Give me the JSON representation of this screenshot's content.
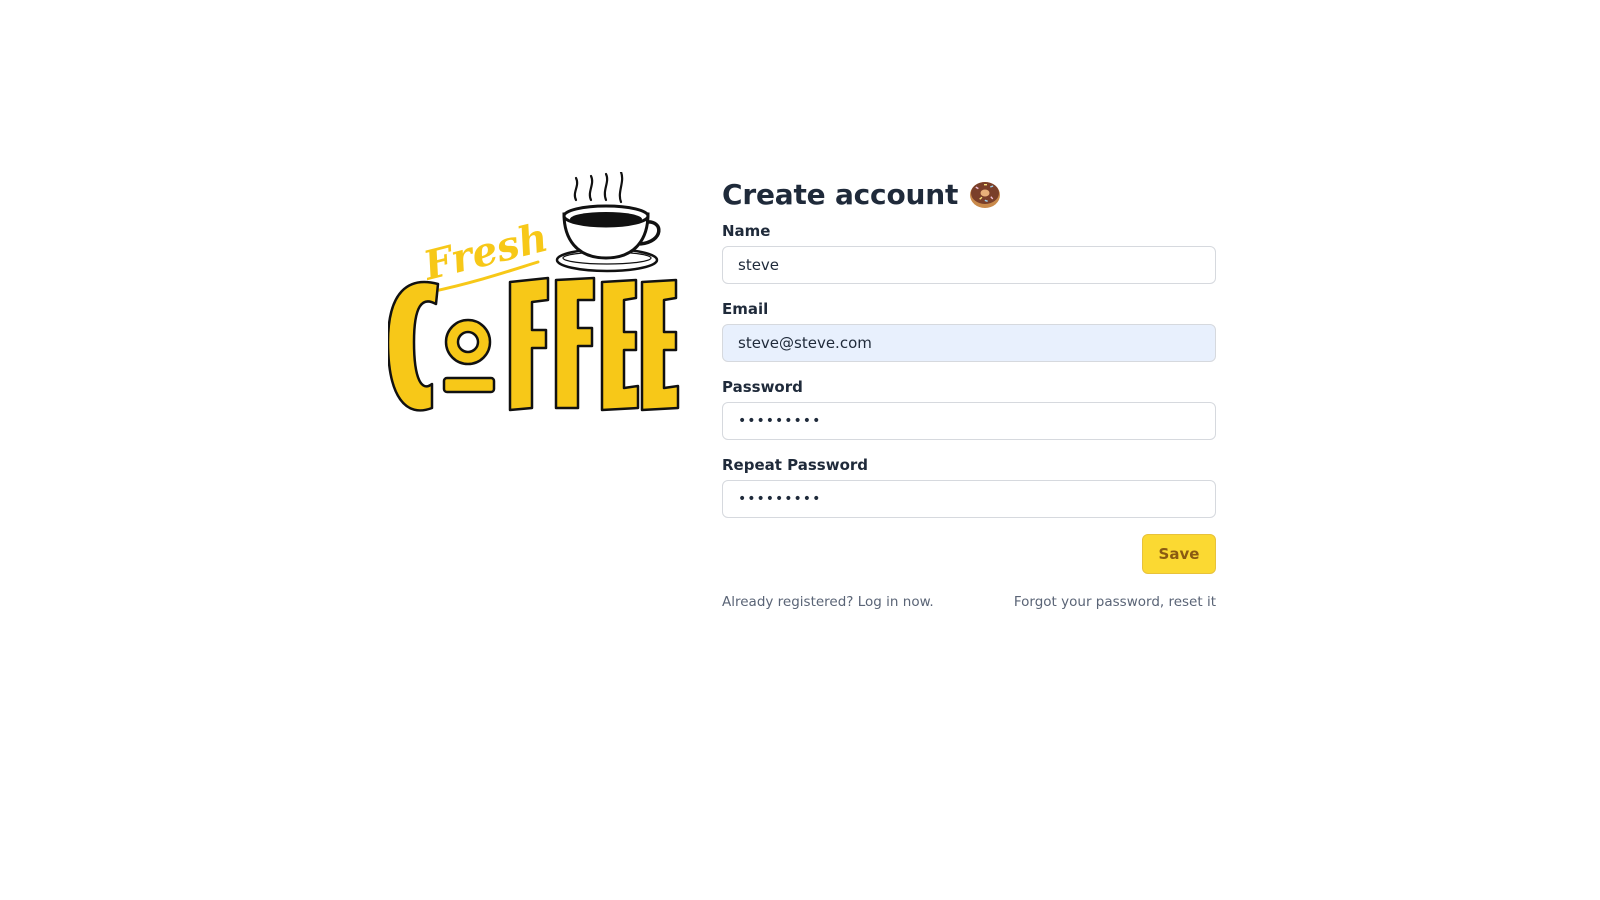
{
  "logo": {
    "script_text": "Fresh",
    "main_text": "COFFEE",
    "brand_color": "#f7c818",
    "icon": "coffee-cup-icon"
  },
  "form": {
    "title": "Create account",
    "title_icon": "donut-icon",
    "name": {
      "label": "Name",
      "value": "steve"
    },
    "email": {
      "label": "Email",
      "value": "steve@steve.com"
    },
    "password": {
      "label": "Password",
      "value": "•••••••••"
    },
    "repeat_password": {
      "label": "Repeat Password",
      "value": "•••••••••"
    },
    "save_label": "Save",
    "login_link": "Already registered? Log in now.",
    "reset_link": "Forgot your password, reset it"
  },
  "colors": {
    "button_bg": "#fbd932",
    "button_text": "#8a5a12",
    "autofill_bg": "#e8f0fd"
  }
}
